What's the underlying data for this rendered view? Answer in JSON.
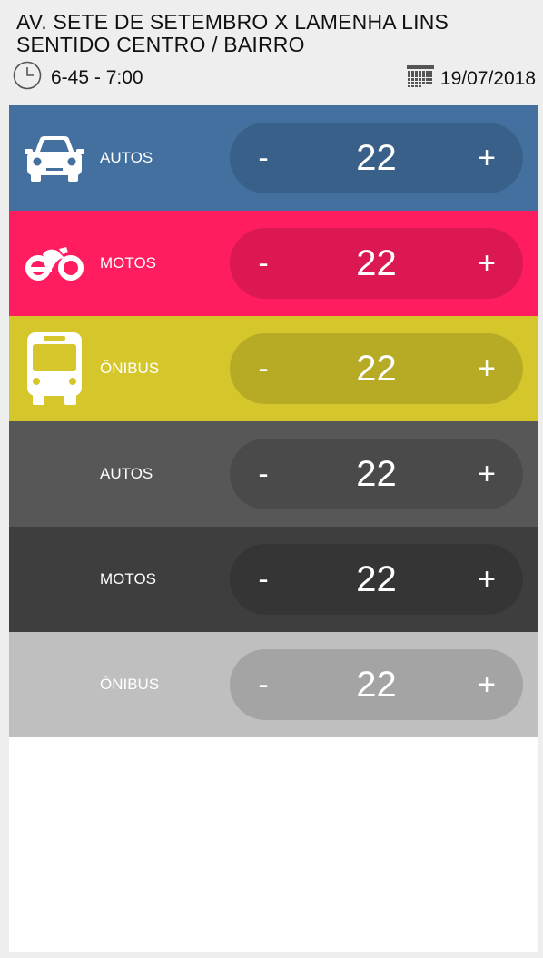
{
  "header": {
    "title_line1": "AV. SETE DE SETEMBRO X LAMENHA LINS",
    "title_line2": "SENTIDO CENTRO / BAIRRO",
    "time_range": "6-45 - 7:00",
    "date": "19/07/2018",
    "time_icon": "clock-icon",
    "date_icon": "calendar-icon"
  },
  "rows": [
    {
      "label": "AUTOS",
      "icon": "car-icon",
      "color": "#43709f",
      "count": "22",
      "minus": "-",
      "plus": "+"
    },
    {
      "label": "MOTOS",
      "icon": "motorcycle-icon",
      "color": "#ff1d5f",
      "count": "22",
      "minus": "-",
      "plus": "+"
    },
    {
      "label": "ÔNIBUS",
      "icon": "bus-icon",
      "color": "#d5c62c",
      "count": "22",
      "minus": "-",
      "plus": "+"
    },
    {
      "label": "AUTOS",
      "icon": "",
      "color": "#575757",
      "count": "22",
      "minus": "-",
      "plus": "+"
    },
    {
      "label": "MOTOS",
      "icon": "",
      "color": "#3e3e3e",
      "count": "22",
      "minus": "-",
      "plus": "+"
    },
    {
      "label": "ÔNIBUS",
      "icon": "",
      "color": "#bfbfbf",
      "count": "22",
      "minus": "-",
      "plus": "+"
    }
  ]
}
